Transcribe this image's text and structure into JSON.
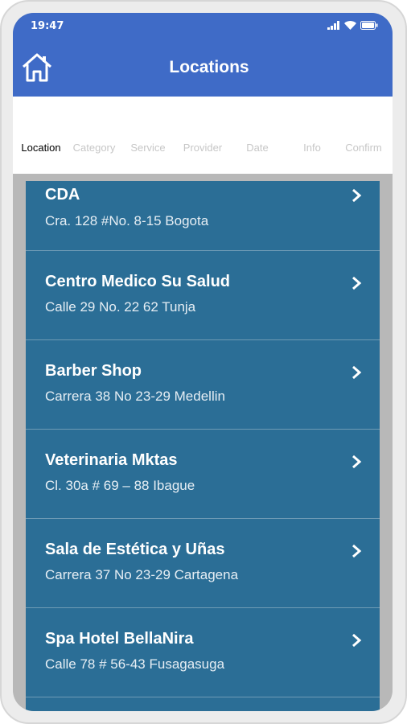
{
  "status_bar": {
    "time": "19:47"
  },
  "header": {
    "title": "Locations"
  },
  "tabs": [
    {
      "label": "Location",
      "active": true
    },
    {
      "label": "Category",
      "active": false
    },
    {
      "label": "Service",
      "active": false
    },
    {
      "label": "Provider",
      "active": false
    },
    {
      "label": "Date",
      "active": false
    },
    {
      "label": "Info",
      "active": false
    },
    {
      "label": "Confirm",
      "active": false
    }
  ],
  "locations": [
    {
      "name": "CDA",
      "address": "Cra. 128 #No. 8-15 Bogota"
    },
    {
      "name": "Centro Medico Su Salud",
      "address": "Calle 29 No. 22 62 Tunja"
    },
    {
      "name": "Barber Shop",
      "address": "Carrera 38 No 23-29 Medellin"
    },
    {
      "name": "Veterinaria Mktas",
      "address": "Cl. 30a  # 69 – 88 Ibague"
    },
    {
      "name": "Sala de Estética y Uñas",
      "address": "Carrera 37 No 23-29 Cartagena"
    },
    {
      "name": "Spa Hotel BellaNira",
      "address": "Calle 78 # 56-43 Fusagasuga"
    }
  ],
  "icons": {
    "home": "home-icon",
    "chevron": "chevron-right-icon",
    "signal": "signal-icon",
    "wifi": "wifi-icon",
    "battery": "battery-icon"
  },
  "colors": {
    "app_bar": "#3f6bc7",
    "list_item": "#2b6e96",
    "divider": "#6f9bb5"
  }
}
